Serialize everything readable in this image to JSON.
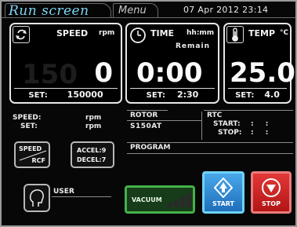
{
  "header": {
    "run_tab": "Run screen",
    "menu_tab": "Menu",
    "datetime": "07 Apr 2012 23:14"
  },
  "speed": {
    "title": "SPEED",
    "unit": "rpm",
    "value": "0",
    "set_label": "SET:",
    "set_value": "150000"
  },
  "time": {
    "title": "TIME",
    "unit": "hh:mm",
    "sub": "Remain",
    "value": "0:00",
    "set_label": "SET:",
    "set_value": "2:30"
  },
  "temp": {
    "title": "TEMP",
    "unit": "°C",
    "value": "25.0",
    "set_label": "SET:",
    "set_value": "4.0"
  },
  "speed_info": {
    "speed_label": "SPEED:",
    "speed_unit": "rpm",
    "set_label": "SET:",
    "set_unit": "rpm"
  },
  "speed_rcf_button": {
    "top": "SPEED",
    "bottom": "RCF"
  },
  "accel_button": {
    "accel": "ACCEL:9",
    "decel": "DECEL:7"
  },
  "rotor": {
    "label": "ROTOR",
    "value": "S150AT"
  },
  "rtc": {
    "label": "RTC",
    "start_label": "START:",
    "stop_label": "STOP:",
    "start_value": ": :",
    "stop_value": ": :"
  },
  "program": {
    "label": "PROGRAM"
  },
  "user": {
    "label": "USER"
  },
  "buttons": {
    "vacuum": "VACUUM",
    "start": "START",
    "stop": "STOP"
  },
  "colors": {
    "run_tab": "#7fd4f2",
    "vacuum": "#46b04a",
    "start": "#2b86d4",
    "stop": "#d62a2a"
  }
}
